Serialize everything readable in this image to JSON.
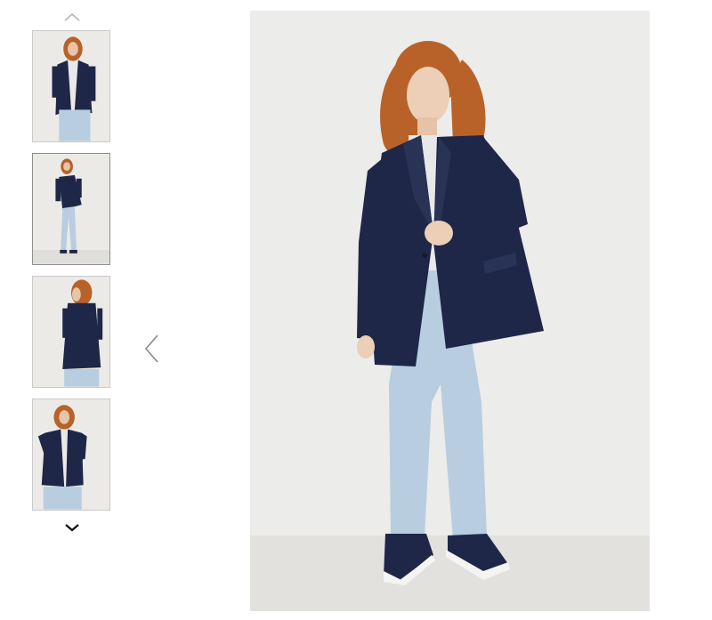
{
  "gallery": {
    "thumbnails": [
      {
        "view": "front-hand-in-pocket"
      },
      {
        "view": "full-length-front"
      },
      {
        "view": "back-view"
      },
      {
        "view": "front-buttoning"
      }
    ],
    "selected_index": 1,
    "main_image": {
      "view": "full-length-front"
    },
    "icons": {
      "scroll_up": "chevron-up-icon",
      "scroll_down": "chevron-down-icon",
      "previous": "chevron-left-icon"
    }
  },
  "colors": {
    "blazer": "#1e2748",
    "jeans": "#b9cde0",
    "background": "#ececea",
    "hair": "#b8622a"
  }
}
